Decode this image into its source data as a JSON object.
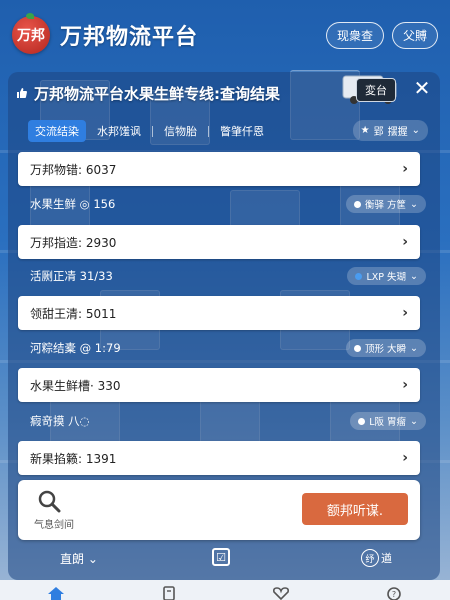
{
  "app": {
    "logo_text": "万邦",
    "title": "万邦物流平台",
    "actions": [
      {
        "label": "现衆查"
      },
      {
        "label": "父賻"
      }
    ]
  },
  "panel": {
    "title": "万邦物流平台水果生鲜专线:查询结果",
    "truck_badge": "変台",
    "close_glyph": "✕",
    "tabs": [
      {
        "label": "交流结染",
        "active": true
      },
      {
        "label": "水邦馐讽",
        "active": false
      },
      {
        "label": "信物胎",
        "active": false
      },
      {
        "label": "瞥肇仟恩",
        "active": false
      }
    ],
    "filter": {
      "label": "郢",
      "value": "摆握"
    },
    "rows": [
      {
        "kind": "card",
        "text": "万邦物错: 6037"
      },
      {
        "kind": "plain",
        "text": "水果生鲜 ◎ 156",
        "pill": "衡驿 方筐"
      },
      {
        "kind": "card",
        "text": "万邦指造: 2930"
      },
      {
        "kind": "plain",
        "text": "活劂正凊 31/33",
        "pill": "LXP 失瑚"
      },
      {
        "kind": "card",
        "text": "领甜王清: 5011"
      },
      {
        "kind": "plain",
        "text": "河粽结橐 @ 1:79",
        "pill": "顶形 大瞬"
      },
      {
        "kind": "card",
        "text": "水果生鲜槽· 330"
      },
      {
        "kind": "plain",
        "text": "瘕竒摸 八◌",
        "pill": "L阪 胃瘤"
      },
      {
        "kind": "card",
        "text": "新果掐籁: 1391"
      }
    ],
    "search": {
      "label": "气息剑间",
      "button": "额邦听谋."
    },
    "bottom": {
      "left": "直朗 ⌄",
      "center": "☑",
      "right": "遒",
      "right_ring": "纾"
    }
  },
  "nav": [
    {
      "icon": "home-icon"
    },
    {
      "icon": "document-icon"
    },
    {
      "icon": "heart-icon"
    },
    {
      "icon": "help-icon"
    }
  ]
}
